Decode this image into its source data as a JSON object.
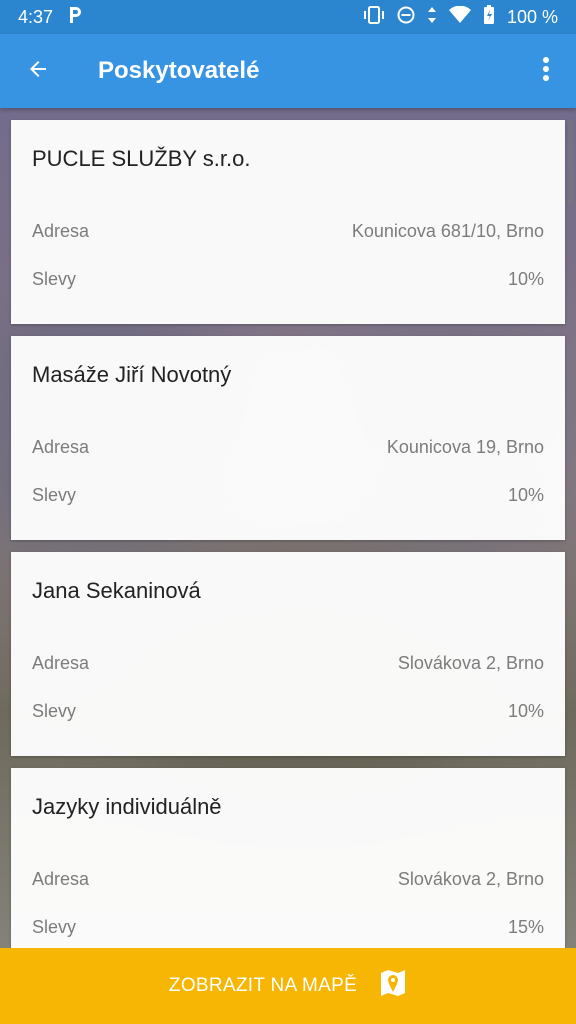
{
  "status_bar": {
    "time": "4:37",
    "battery": "100 %",
    "icons": [
      "parking-icon",
      "vibrate-icon",
      "dnd-icon",
      "data-icon",
      "wifi-icon",
      "battery-icon"
    ]
  },
  "app_bar": {
    "title": "Poskytovatelé",
    "back_icon": "arrow-back-icon",
    "menu_icon": "more-vert-icon",
    "color": "#3694e3"
  },
  "providers": [
    {
      "name": "PUCLE SLUŽBY s.r.o.",
      "address_label": "Adresa",
      "address": "Kounicova 681/10, Brno",
      "discount_label": "Slevy",
      "discount": "10%"
    },
    {
      "name": "Masáže Jiří Novotný",
      "address_label": "Adresa",
      "address": "Kounicova 19, Brno",
      "discount_label": "Slevy",
      "discount": "10%"
    },
    {
      "name": "Jana Sekaninová",
      "address_label": "Adresa",
      "address": "Slovákova 2, Brno",
      "discount_label": "Slevy",
      "discount": "10%"
    },
    {
      "name": "Jazyky individuálně",
      "address_label": "Adresa",
      "address": "Slovákova 2, Brno",
      "discount_label": "Slevy",
      "discount": "15%"
    }
  ],
  "bottom_button": {
    "label": "ZOBRAZIT NA MAPĚ",
    "icon": "map-marker-icon",
    "color": "#f7b603"
  }
}
